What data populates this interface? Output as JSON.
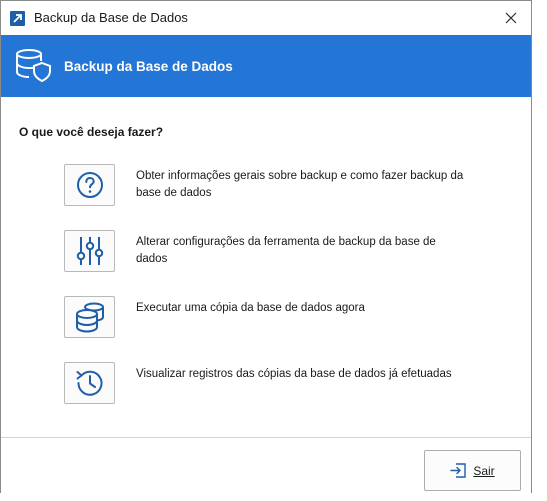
{
  "window": {
    "title": "Backup da Base de Dados"
  },
  "banner": {
    "title": "Backup da Base de Dados"
  },
  "main": {
    "question": "O que você deseja fazer?",
    "options": [
      {
        "icon": "help-icon",
        "label": "Obter informações gerais sobre backup e como fazer backup da base de dados"
      },
      {
        "icon": "sliders-icon",
        "label": "Alterar configurações da ferramenta de backup da base de dados"
      },
      {
        "icon": "database-copy-icon",
        "label": "Executar uma cópia da base de dados agora"
      },
      {
        "icon": "history-icon",
        "label": "Visualizar registros das cópias da base de dados já efetuadas"
      }
    ]
  },
  "footer": {
    "exit_label": "Sair"
  },
  "colors": {
    "accent": "#2376d6",
    "icon_blue": "#1f5fa8"
  }
}
